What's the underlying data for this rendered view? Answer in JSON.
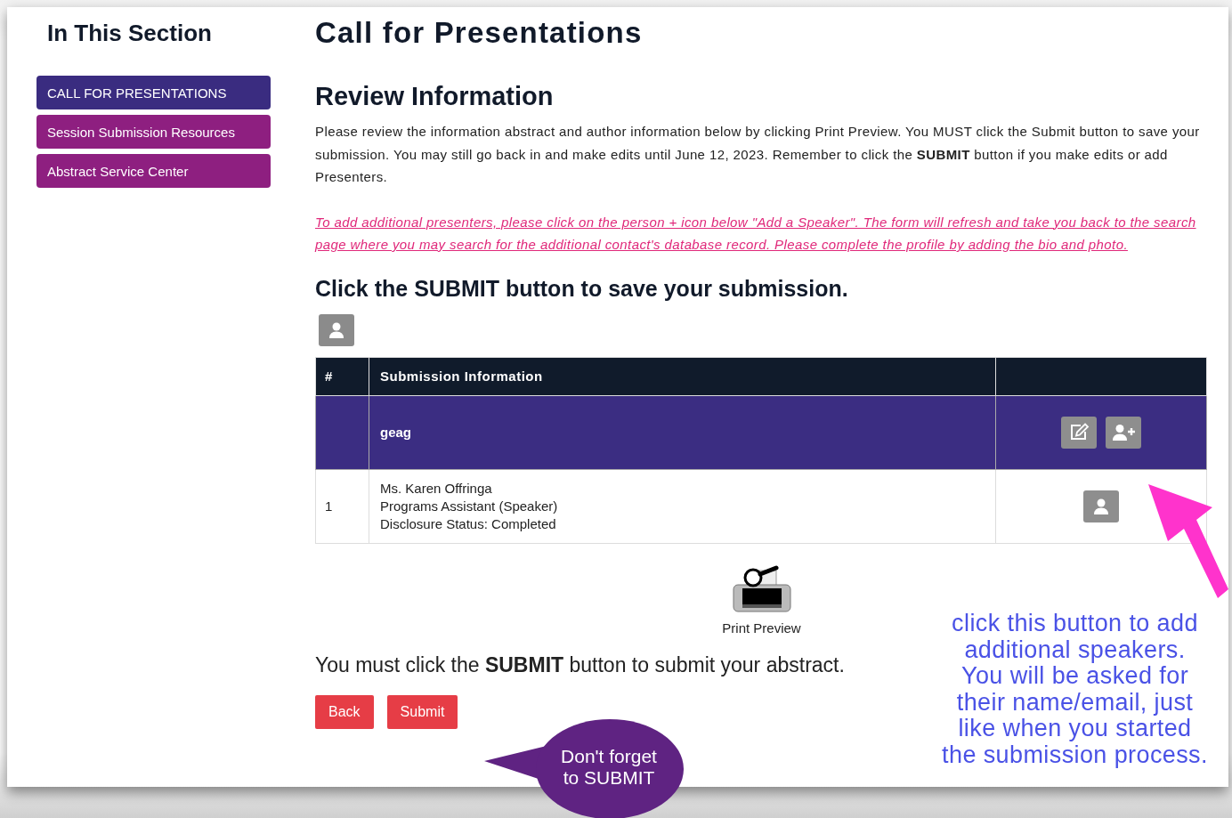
{
  "sidebar": {
    "title": "In This Section",
    "items": [
      {
        "label": "CALL FOR PRESENTATIONS",
        "selected": true
      },
      {
        "label": "Session Submission Resources",
        "selected": false
      },
      {
        "label": "Abstract Service Center",
        "selected": false
      }
    ]
  },
  "main": {
    "title": "Call for Presentations",
    "section_title": "Review Information",
    "intro": "Please review the information abstract and author information below by clicking Print Preview. You MUST click the Submit button to save your submission. You may still go back in and make edits until June 12, 2023. Remember to click the **SUBMIT** button if you make edits or add Presenters.",
    "notice": "To add additional presenters, please click on the person + icon below \"Add a Speaker\". The form will refresh and take you back to the search page where you may search for the additional contact's database record. Please complete the profile by adding the bio and photo.",
    "submit_heading": "Click the **SUBMIT** button to save your submission.",
    "table": {
      "columns": [
        "#",
        "Submission Information"
      ],
      "group_row": {
        "title": "geag"
      },
      "rows": [
        {
          "number": "1",
          "lines": [
            "Ms. Karen Offringa",
            "Programs Assistant (Speaker)",
            "Disclosure Status: Completed"
          ]
        }
      ]
    },
    "print_preview": {
      "label": "Print Preview"
    },
    "reminder": "You must click the **SUBMIT** button to submit your abstract.",
    "buttons": [
      "Back",
      "Submit"
    ]
  },
  "annotations": {
    "callout": "Don't forget to SUBMIT",
    "note_lines": [
      "click this button to add",
      "additional speakers.",
      "You will be asked for",
      "their name/email, just",
      "like when you started",
      "the submission process."
    ]
  }
}
